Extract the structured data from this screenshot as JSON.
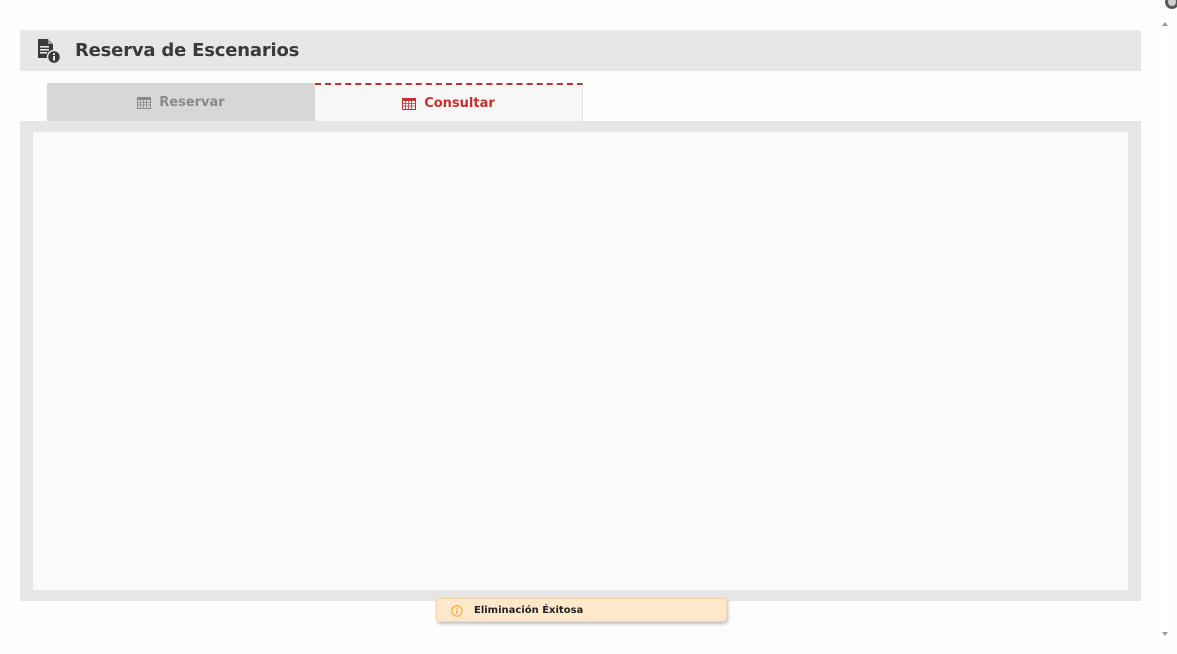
{
  "header": {
    "title": "Reserva de Escenarios",
    "icon": "document-info-icon"
  },
  "tabs": [
    {
      "label": "Reservar",
      "icon": "calendar-icon",
      "active": false
    },
    {
      "label": "Consultar",
      "icon": "calendar-icon",
      "active": true
    }
  ],
  "toast": {
    "message": "Eliminación Éxitosa",
    "icon": "info-icon"
  },
  "colors": {
    "accent": "#c3302f",
    "header_bg": "#e7e7e7",
    "toast_bg": "#fde8cc"
  }
}
